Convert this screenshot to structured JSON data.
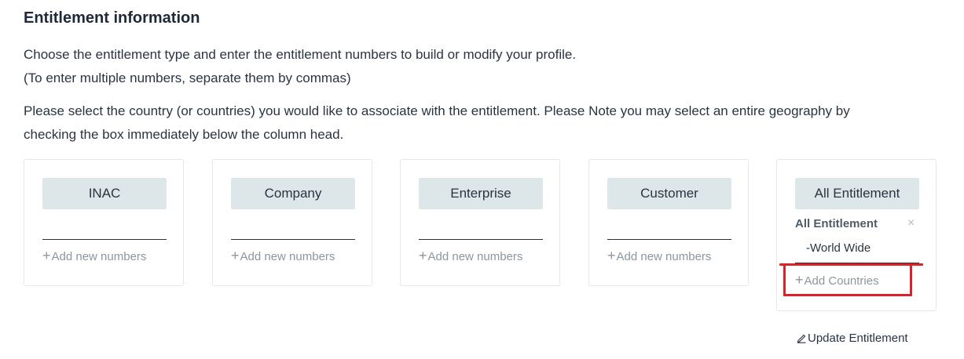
{
  "section": {
    "title": "Entitlement information",
    "intro_line1": "Choose the entitlement type and enter the entitlement numbers to build or modify your profile.",
    "intro_line2": "(To enter multiple numbers, separate them by commas)",
    "country_line1": "Please select the country (or countries) you would like to associate with the entitlement. Please Note you may select an entire geography by",
    "country_line2": "checking the box immediately below the column head."
  },
  "columns": [
    {
      "label": "INAC",
      "input_value": "",
      "add_label": "Add new numbers"
    },
    {
      "label": "Company",
      "input_value": "",
      "add_label": "Add new numbers"
    },
    {
      "label": "Enterprise",
      "input_value": "",
      "add_label": "Add new numbers"
    },
    {
      "label": "Customer",
      "input_value": "",
      "add_label": "Add new numbers"
    }
  ],
  "all_entitlement": {
    "label": "All Entitlement",
    "selected_label": "All Entitlement",
    "close_symbol": "×",
    "country": "-World Wide",
    "add_label": "Add Countries"
  },
  "update_label": "Update Entitlement",
  "icons": {
    "plus": "plus-icon",
    "close": "close-icon",
    "edit": "pencil-icon"
  },
  "colors": {
    "button_bg": "#dde6e8",
    "link_muted": "#8c969f",
    "highlight": "#d8232a"
  }
}
